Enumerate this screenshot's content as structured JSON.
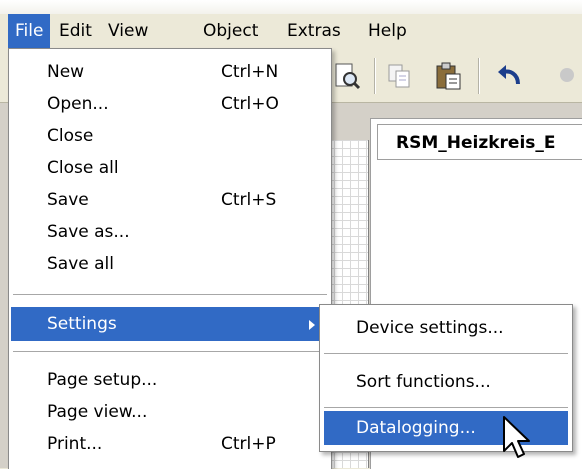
{
  "menubar": {
    "items": [
      {
        "label": "File",
        "active": true
      },
      {
        "label": "Edit"
      },
      {
        "label": "View"
      },
      {
        "label": "Object"
      },
      {
        "label": "Extras"
      },
      {
        "label": "Help"
      }
    ]
  },
  "toolbar": {
    "icons": [
      "print-preview-icon",
      "copy-icon",
      "paste-icon",
      "undo-icon"
    ]
  },
  "document": {
    "tab_label": "RSM_Heizkreis_E"
  },
  "file_menu": {
    "items": [
      {
        "label": "New",
        "shortcut": "Ctrl+N"
      },
      {
        "label": "Open...",
        "shortcut": "Ctrl+O"
      },
      {
        "label": "Close",
        "shortcut": ""
      },
      {
        "label": "Close all",
        "shortcut": ""
      },
      {
        "label": "Save",
        "shortcut": "Ctrl+S"
      },
      {
        "label": "Save as...",
        "shortcut": ""
      },
      {
        "label": "Save all",
        "shortcut": ""
      },
      {
        "label": "Settings",
        "shortcut": "",
        "highlighted": true,
        "submenu": true
      },
      {
        "label": "Page setup...",
        "shortcut": ""
      },
      {
        "label": "Page view...",
        "shortcut": ""
      },
      {
        "label": "Print...",
        "shortcut": "Ctrl+P"
      }
    ]
  },
  "settings_submenu": {
    "items": [
      {
        "label": "Device settings..."
      },
      {
        "label": "Sort functions..."
      },
      {
        "label": "Datalogging...",
        "highlighted": true
      }
    ]
  },
  "colors": {
    "highlight": "#316ac5",
    "face": "#ece9d8"
  }
}
